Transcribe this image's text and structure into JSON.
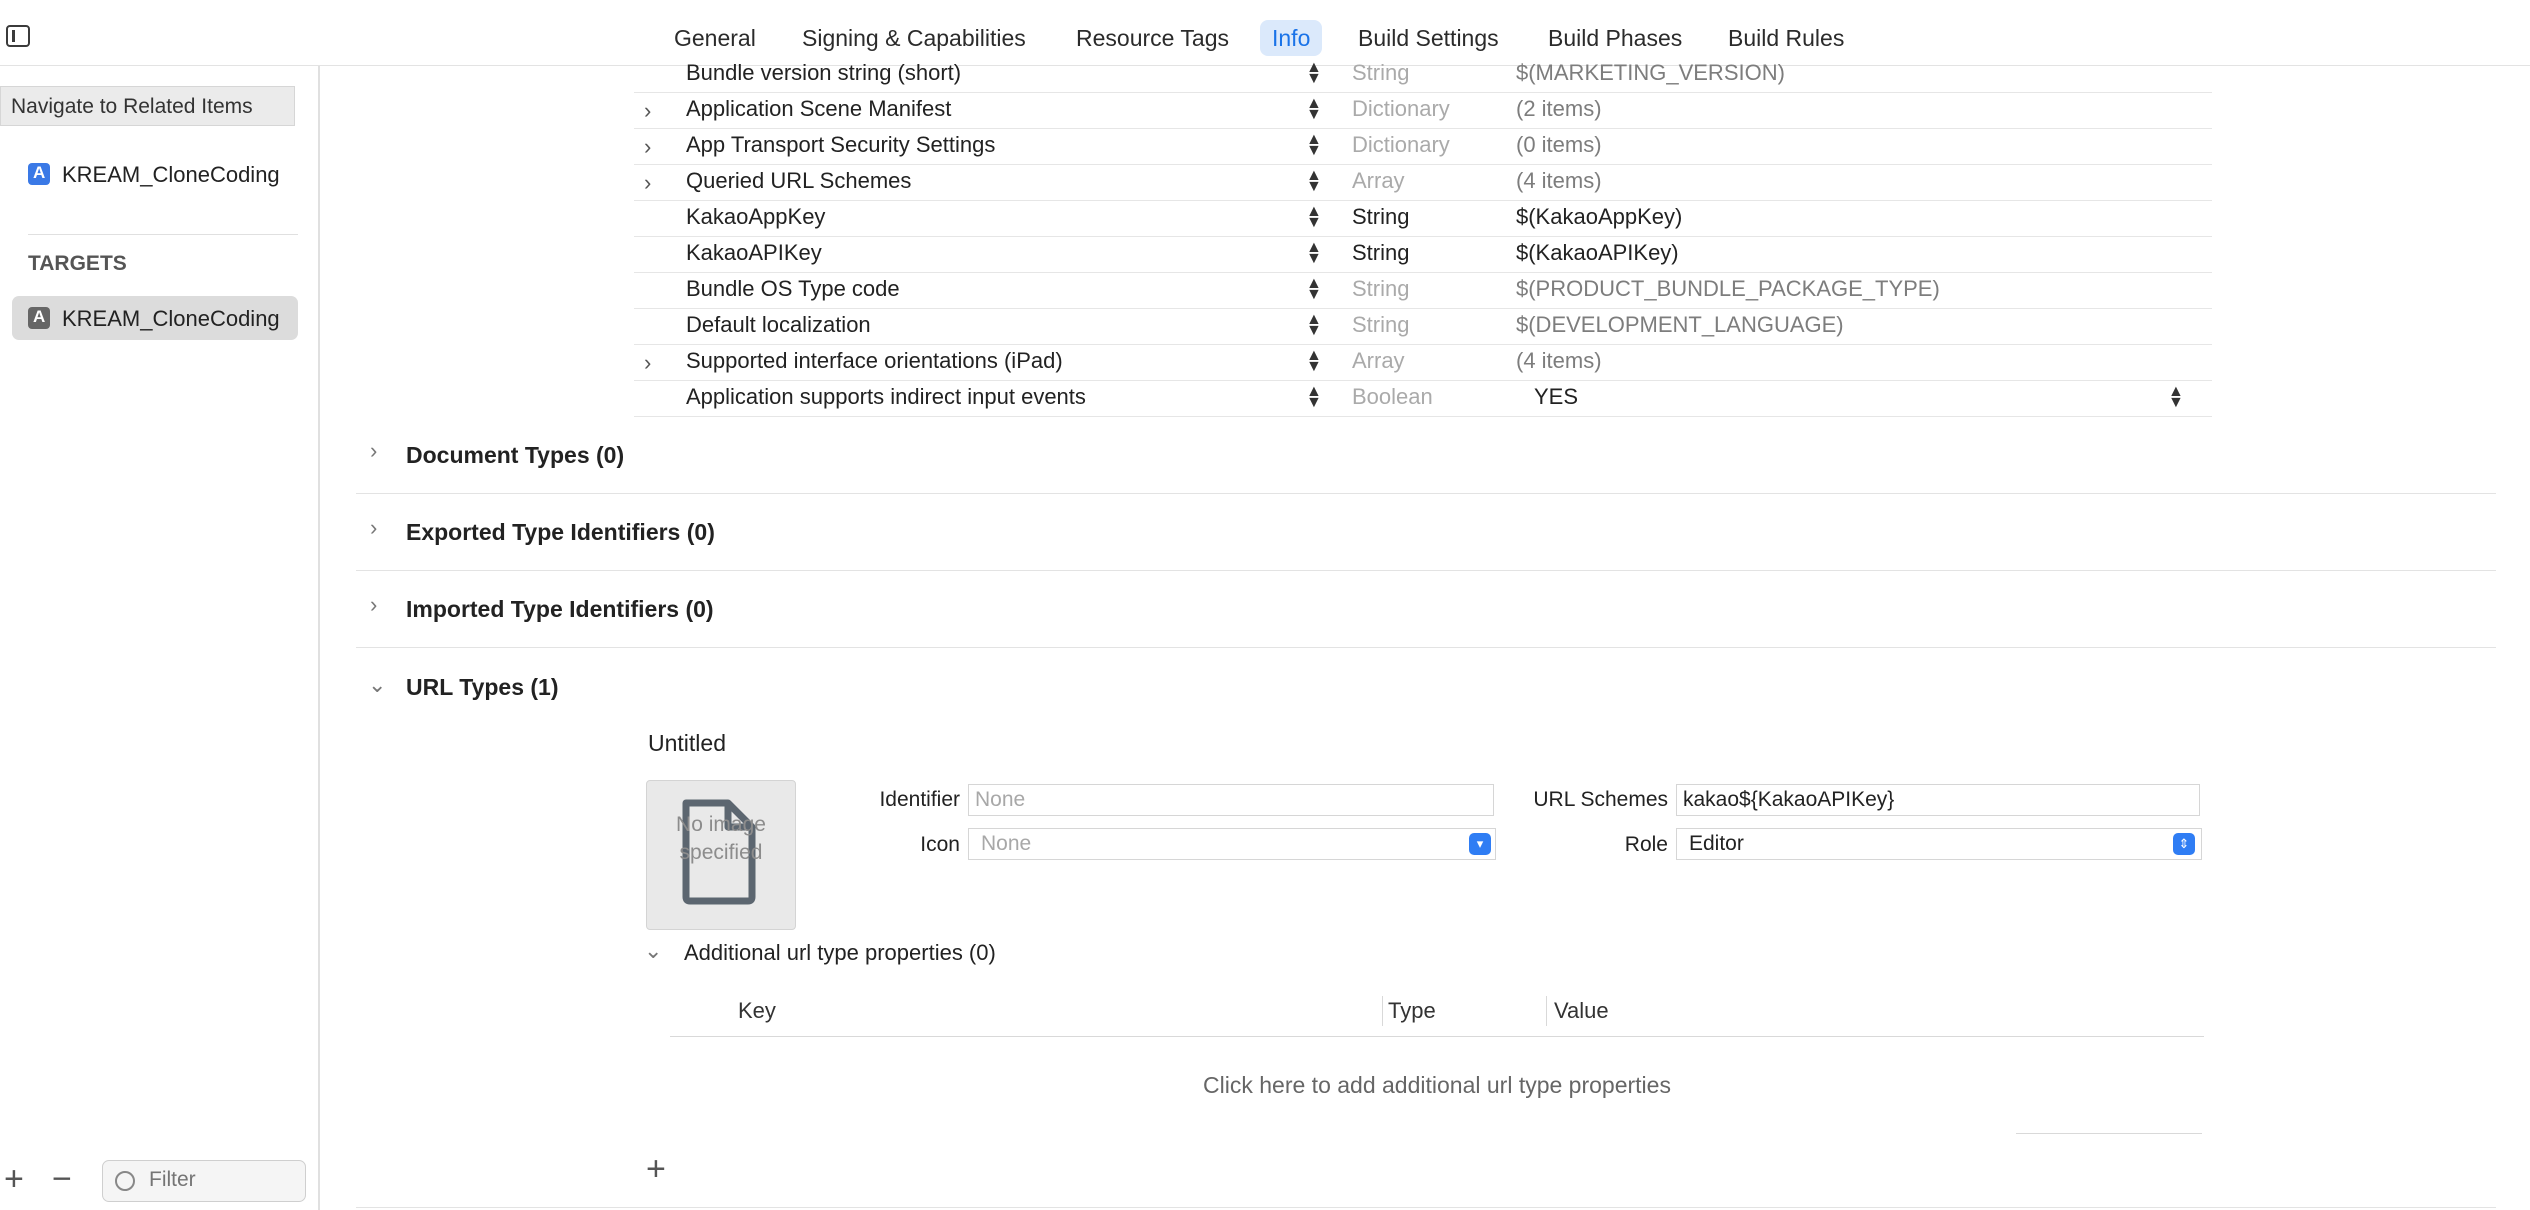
{
  "tabs": [
    {
      "label": "General",
      "active": false
    },
    {
      "label": "Signing & Capabilities",
      "active": false
    },
    {
      "label": "Resource Tags",
      "active": false
    },
    {
      "label": "Info",
      "active": true
    },
    {
      "label": "Build Settings",
      "active": false
    },
    {
      "label": "Build Phases",
      "active": false
    },
    {
      "label": "Build Rules",
      "active": false
    }
  ],
  "sidebar": {
    "tooltip": "Navigate to Related Items",
    "project_name": "KREAM_CloneCoding",
    "targets_header": "TARGETS",
    "target_name": "KREAM_CloneCoding",
    "filter_placeholder": "Filter"
  },
  "plist_rows": [
    {
      "key": "Bundle version string (short)",
      "type": "String",
      "value": "$(MARKETING_VERSION)",
      "expandable": false,
      "dim": true
    },
    {
      "key": "Application Scene Manifest",
      "type": "Dictionary",
      "value": "(2 items)",
      "expandable": true,
      "dim": true
    },
    {
      "key": "App Transport Security Settings",
      "type": "Dictionary",
      "value": "(0 items)",
      "expandable": true,
      "dim": true
    },
    {
      "key": "Queried URL Schemes",
      "type": "Array",
      "value": "(4 items)",
      "expandable": true,
      "dim": true
    },
    {
      "key": "KakaoAppKey",
      "type": "String",
      "value": "$(KakaoAppKey)",
      "expandable": false,
      "dim": false
    },
    {
      "key": "KakaoAPIKey",
      "type": "String",
      "value": "$(KakaoAPIKey)",
      "expandable": false,
      "dim": false
    },
    {
      "key": "Bundle OS Type code",
      "type": "String",
      "value": "$(PRODUCT_BUNDLE_PACKAGE_TYPE)",
      "expandable": false,
      "dim": true
    },
    {
      "key": "Default localization",
      "type": "String",
      "value": "$(DEVELOPMENT_LANGUAGE)",
      "expandable": false,
      "dim": true
    },
    {
      "key": "Supported interface orientations (iPad)",
      "type": "Array",
      "value": "(4 items)",
      "expandable": true,
      "dim": true
    },
    {
      "key": "Application supports indirect input events",
      "type": "Boolean",
      "value": "YES",
      "expandable": false,
      "dim": true
    }
  ],
  "sections": [
    {
      "title": "Document Types (0)",
      "expanded": false
    },
    {
      "title": "Exported Type Identifiers (0)",
      "expanded": false
    },
    {
      "title": "Imported Type Identifiers (0)",
      "expanded": false
    },
    {
      "title": "URL Types (1)",
      "expanded": true
    }
  ],
  "url_type": {
    "name": "Untitled",
    "image_placeholder": "No image specified",
    "identifier_label": "Identifier",
    "identifier_placeholder": "None",
    "icon_label": "Icon",
    "icon_value": "None",
    "url_schemes_label": "URL Schemes",
    "url_schemes_value": "kakao${KakaoAPIKey}",
    "role_label": "Role",
    "role_value": "Editor",
    "additional_label": "Additional url type properties (0)",
    "columns": [
      "Key",
      "Type",
      "Value"
    ],
    "add_hint": "Click here to add additional url type properties"
  },
  "colors": {
    "accent": "#2f7df4",
    "active_tab_bg": "#dbe9fb",
    "active_tab_text": "#1a73e8"
  }
}
